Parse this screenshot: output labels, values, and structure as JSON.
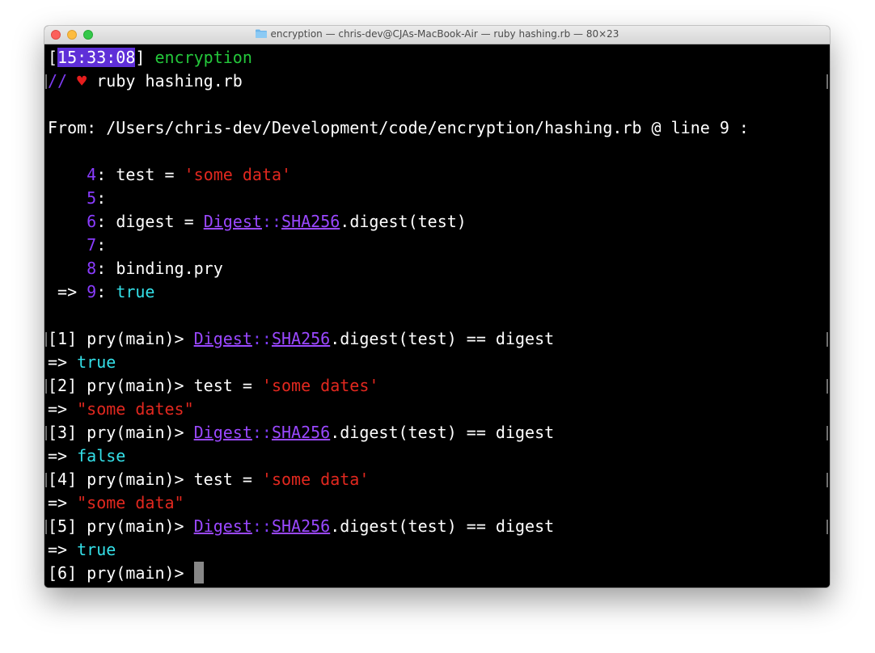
{
  "window": {
    "title": "encryption — chris-dev@CJAs-MacBook-Air — ruby hashing.rb — 80×23"
  },
  "prompt": {
    "open_bracket": "[",
    "time": "15:33:08",
    "close_bracket": "]",
    "dir": "encryption",
    "slashes": "//",
    "heart": "♥",
    "command": "ruby hashing.rb"
  },
  "from_line": "From: /Users/chris-dev/Development/code/encryption/hashing.rb @ line 9 :",
  "source": {
    "l4": {
      "num": "4",
      "code": "test = ",
      "str": "'some data'"
    },
    "l5": {
      "num": "5"
    },
    "l6": {
      "num": "6",
      "code": "digest = ",
      "const1": "Digest",
      "sep": "::",
      "const2": "SHA256",
      "rest": ".digest(test)"
    },
    "l7": {
      "num": "7"
    },
    "l8": {
      "num": "8",
      "code": "binding.pry"
    },
    "l9": {
      "arrow": " => ",
      "num": "9",
      "code": "true"
    }
  },
  "repl": [
    {
      "prompt": "[1] pry(main)> ",
      "const1": "Digest",
      "sep": "::",
      "const2": "SHA256",
      "rest": ".digest(test) == digest",
      "result_arrow": "=> ",
      "result": "true"
    },
    {
      "prompt": "[2] pry(main)> ",
      "code": "test = ",
      "str": "'some dates'",
      "result_arrow": "=> ",
      "result": "\"some dates\""
    },
    {
      "prompt": "[3] pry(main)> ",
      "const1": "Digest",
      "sep": "::",
      "const2": "SHA256",
      "rest": ".digest(test) == digest",
      "result_arrow": "=> ",
      "result": "false"
    },
    {
      "prompt": "[4] pry(main)> ",
      "code": "test = ",
      "str": "'some data'",
      "result_arrow": "=> ",
      "result": "\"some data\""
    },
    {
      "prompt": "[5] pry(main)> ",
      "const1": "Digest",
      "sep": "::",
      "const2": "SHA256",
      "rest": ".digest(test) == digest",
      "result_arrow": "=> ",
      "result": "true"
    },
    {
      "prompt": "[6] pry(main)> "
    }
  ],
  "colors": {
    "timestamp_bg": "#5f2fd8",
    "dir": "#24c73b",
    "string": "#e2281f",
    "boolean": "#34e0e8",
    "line_number": "#8a3cff",
    "constant": "#9a48ff"
  }
}
